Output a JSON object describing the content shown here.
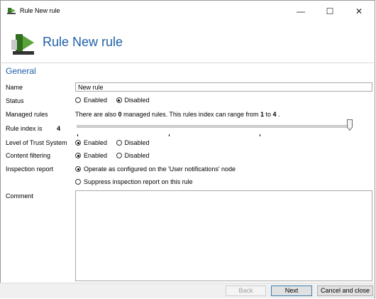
{
  "window": {
    "title": "Rule New rule",
    "minimize_glyph": "—",
    "maximize_glyph": "☐",
    "close_glyph": "✕"
  },
  "header": {
    "title": "Rule New rule"
  },
  "section": {
    "title": "General"
  },
  "fields": {
    "name": {
      "label": "Name",
      "value": "New rule"
    },
    "status": {
      "label": "Status",
      "options": [
        "Enabled",
        "Disabled"
      ],
      "selected": "Disabled"
    },
    "managed_rules": {
      "label": "Managed rules",
      "text_before": "There are also ",
      "count": "0",
      "text_middle": " managed rules. This rules index can range from ",
      "range_min": "1",
      "text_to": " to ",
      "range_max": "4",
      "text_end": " ."
    },
    "rule_index": {
      "label": "Rule index is",
      "value": "4",
      "min": 1,
      "max": 4,
      "current": 4
    },
    "trust": {
      "label": "Level of Trust System",
      "options": [
        "Enabled",
        "Disabled"
      ],
      "selected": "Enabled"
    },
    "content": {
      "label": "Content filtering",
      "options": [
        "Enabled",
        "Disabled"
      ],
      "selected": "Enabled"
    },
    "inspection": {
      "label": "Inspection report",
      "options": [
        "Operate as configured on the 'User notifications' node",
        "Suppress inspection report on this rule"
      ],
      "selected": "Operate as configured on the 'User notifications' node"
    },
    "comment": {
      "label": "Comment",
      "value": ""
    }
  },
  "footer": {
    "back_label": "Back",
    "next_label": "Next",
    "cancel_label": "Cancel and close"
  },
  "icons": {
    "app": "rule-icon",
    "slider_thumb": "slider-thumb-icon"
  },
  "colors": {
    "accent": "#1e5fa8"
  }
}
